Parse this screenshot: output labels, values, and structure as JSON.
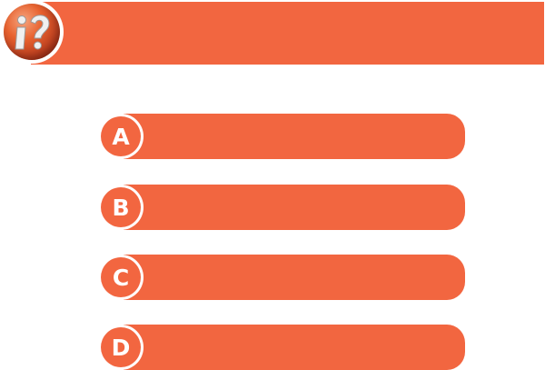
{
  "question": {
    "text": ""
  },
  "logo": {
    "icon": "question-exclamation-icon"
  },
  "answers": [
    {
      "letter": "A",
      "text": ""
    },
    {
      "letter": "B",
      "text": ""
    },
    {
      "letter": "C",
      "text": ""
    },
    {
      "letter": "D",
      "text": ""
    }
  ],
  "colors": {
    "accent": "#f26640",
    "background": "#ffffff",
    "text": "#ffffff"
  }
}
